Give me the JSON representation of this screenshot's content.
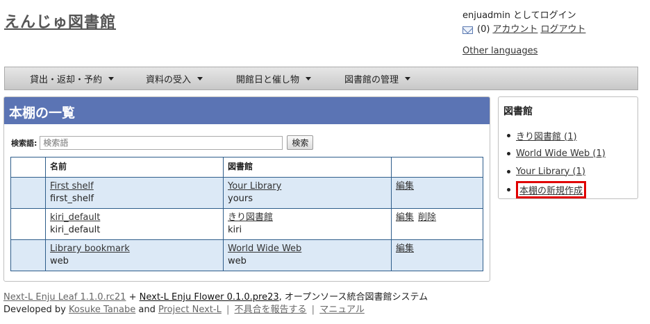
{
  "header": {
    "site_title": "えんじゅ図書館",
    "login_text": "enjuadmin としてログイン",
    "message_count": "(0)",
    "account_link": "アカウント",
    "logout_link": "ログアウト",
    "other_languages": "Other languages"
  },
  "nav": [
    {
      "label": "貸出・返却・予約"
    },
    {
      "label": "資料の受入"
    },
    {
      "label": "開館日と催し物"
    },
    {
      "label": "図書館の管理"
    }
  ],
  "main": {
    "title": "本棚の一覧",
    "search_label": "検索語:",
    "search_placeholder": "検索語",
    "search_button": "検索",
    "table": {
      "headers": [
        "",
        "名前",
        "図書館",
        ""
      ],
      "rows": [
        {
          "name": "First shelf",
          "key": "first_shelf",
          "library": "Your Library",
          "library_key": "yours",
          "edit": "編集",
          "delete": ""
        },
        {
          "name": "kiri_default",
          "key": "kiri_default",
          "library": "きり図書館",
          "library_key": "kiri",
          "edit": "編集",
          "delete": "削除"
        },
        {
          "name": "Library bookmark",
          "key": "web",
          "library": "World Wide Web",
          "library_key": "web",
          "edit": "編集",
          "delete": ""
        }
      ]
    }
  },
  "sidebar": {
    "title": "図書館",
    "items": [
      {
        "label": "きり図書館 (1)"
      },
      {
        "label": "World Wide Web (1)"
      },
      {
        "label": "Your Library (1)"
      },
      {
        "label": "本棚の新規作成",
        "highlight": "#e00000"
      }
    ]
  },
  "footer": {
    "leaf": "Next-L Enju Leaf 1.1.0.rc21",
    "plus": "+",
    "flower": "Next-L Enju Flower 0.1.0.pre23",
    "desc": ", オープンソース統合図書館システム",
    "developed_by": "Developed by",
    "author": "Kosuke Tanabe",
    "and": "and",
    "project": "Project Next-L",
    "sep": "|",
    "report": "不具合を報告する",
    "manual": "マニュアル"
  },
  "icons": {
    "mail": "mail-icon",
    "caret": "caret-down-icon"
  }
}
